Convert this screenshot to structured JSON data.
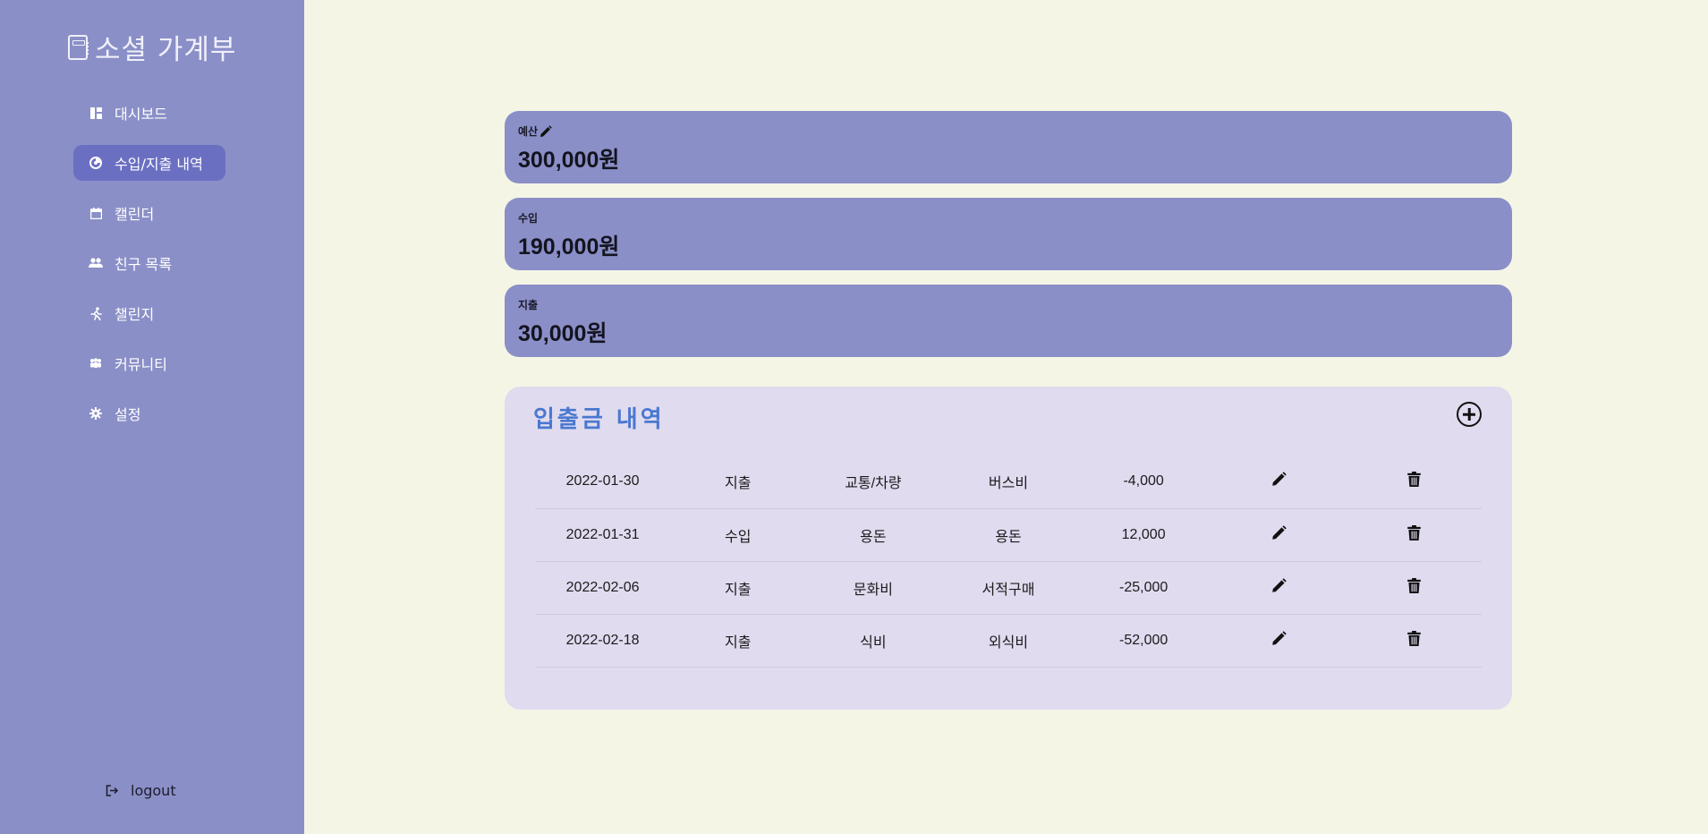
{
  "brand": {
    "title": "소셜 가계부",
    "icon": "book-icon"
  },
  "sidebar": {
    "items": [
      {
        "label": "대시보드",
        "icon": "dashboard-icon",
        "active": false
      },
      {
        "label": "수입/지출 내역",
        "icon": "chart-icon",
        "active": true
      },
      {
        "label": "캘린더",
        "icon": "calendar-icon",
        "active": false
      },
      {
        "label": "친구 목록",
        "icon": "people-icon",
        "active": false
      },
      {
        "label": "챌린지",
        "icon": "running-icon",
        "active": false
      },
      {
        "label": "커뮤니티",
        "icon": "community-icon",
        "active": false
      },
      {
        "label": "설정",
        "icon": "gear-icon",
        "active": false
      }
    ],
    "logout_label": "logout"
  },
  "summary": {
    "budget": {
      "label": "예산",
      "value": "300,000원"
    },
    "income": {
      "label": "수입",
      "value": "190,000원"
    },
    "expense": {
      "label": "지출",
      "value": "30,000원"
    }
  },
  "transactions": {
    "title": "입출금 내역",
    "rows": [
      {
        "date": "2022-01-30",
        "type": "지출",
        "category": "교통/차량",
        "detail": "버스비",
        "amount": "-4,000"
      },
      {
        "date": "2022-01-31",
        "type": "수입",
        "category": "용돈",
        "detail": "용돈",
        "amount": "12,000"
      },
      {
        "date": "2022-02-06",
        "type": "지출",
        "category": "문화비",
        "detail": "서적구매",
        "amount": "-25,000"
      },
      {
        "date": "2022-02-18",
        "type": "지출",
        "category": "식비",
        "detail": "외식비",
        "amount": "-52,000"
      }
    ]
  },
  "colors": {
    "background": "#f5f5e6",
    "sidebar": "#8a8fc7",
    "active_nav": "#6b6fc2",
    "card": "#8a8fc7",
    "panel": "#e0dbef",
    "title_accent": "#4a78d0"
  }
}
